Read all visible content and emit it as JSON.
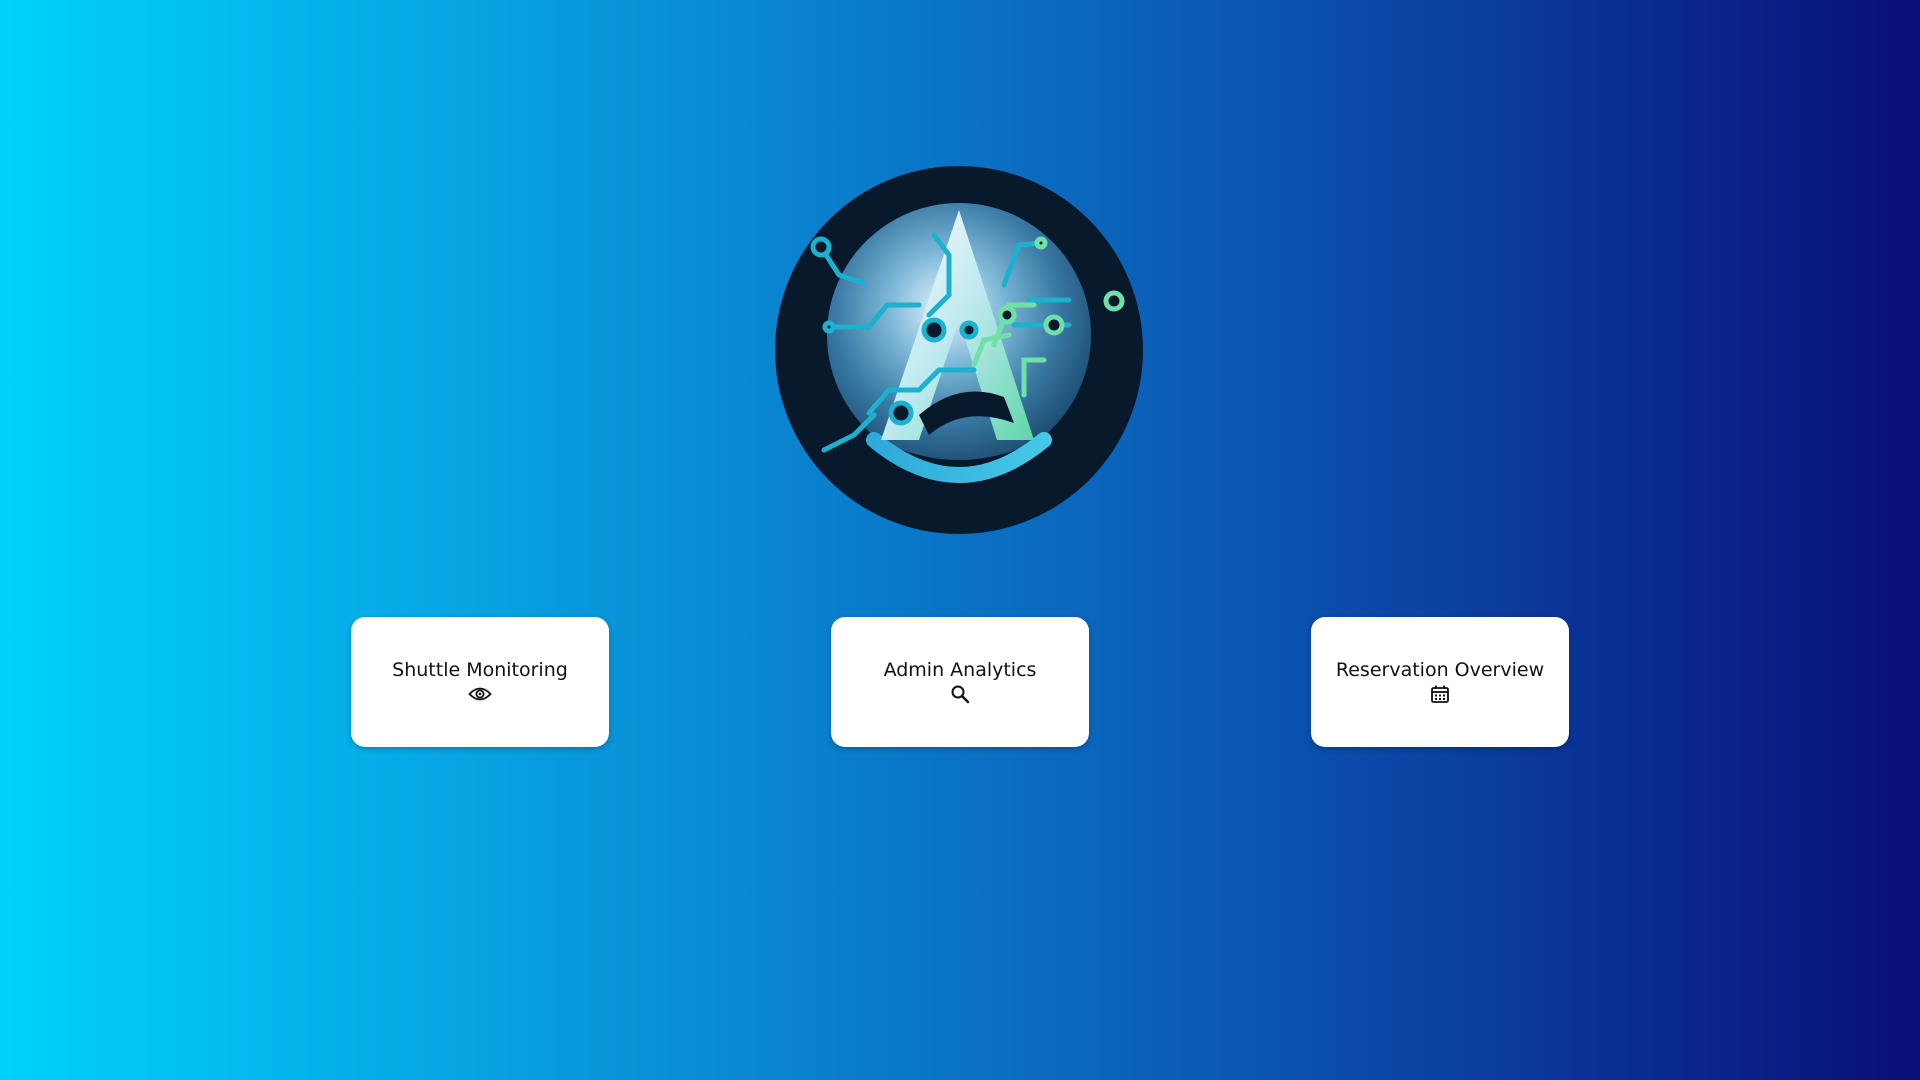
{
  "logo": {
    "name": "company-logo"
  },
  "colors": {
    "gradient_start": "#00d2fe",
    "gradient_end": "#0a0e7a",
    "card_bg": "#ffffff"
  },
  "nav_cards": [
    {
      "label": "Shuttle Monitoring",
      "icon": "eye-icon"
    },
    {
      "label": "Admin Analytics",
      "icon": "search-icon"
    },
    {
      "label": "Reservation Overview",
      "icon": "calendar-icon"
    }
  ]
}
